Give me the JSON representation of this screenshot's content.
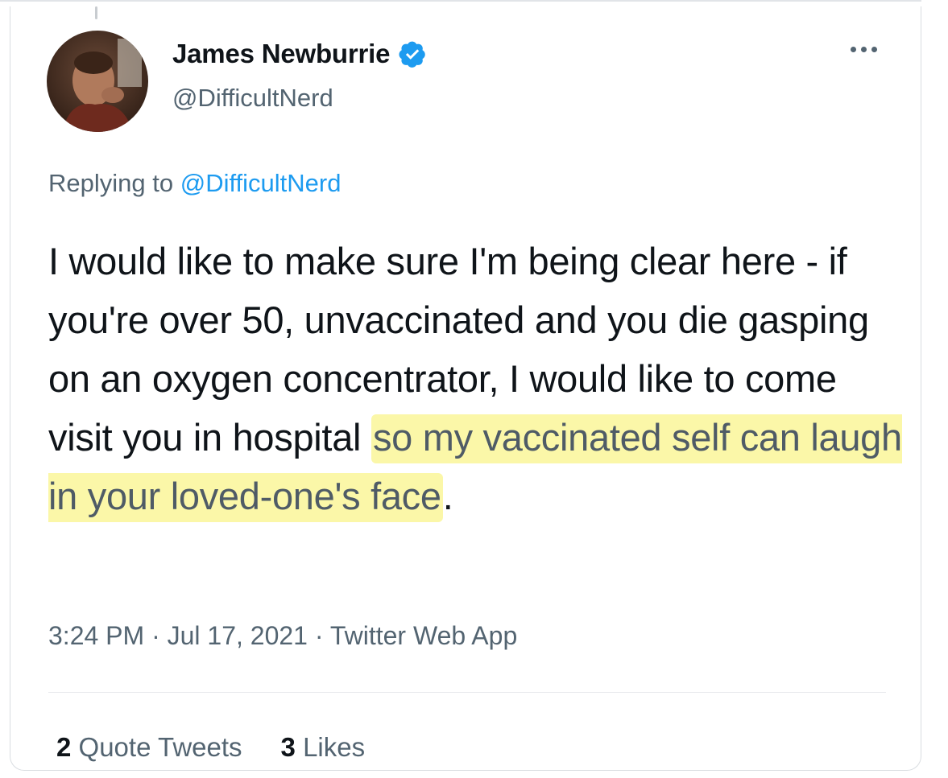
{
  "author": {
    "display_name": "James Newburrie",
    "handle": "@DifficultNerd",
    "verified_icon": "verified-badge-icon",
    "avatar_icon": "avatar-photo"
  },
  "reply": {
    "prefix": "Replying to ",
    "mention": "@DifficultNerd"
  },
  "tweet": {
    "text_plain": "I would like to make sure I'm being clear here - if you're over 50, unvaccinated and you die gasping on an oxygen concentrator, I would like to come visit you in hospital",
    "text_highlight": "so my vaccinated self can laugh in your loved-one's face",
    "text_end": ".",
    "highlight_color": "#fbf7a8"
  },
  "meta": {
    "time": "3:24 PM",
    "separator": " · ",
    "date": "Jul 17, 2021",
    "source": "Twitter Web App"
  },
  "stats": {
    "quote_count": "2",
    "quote_label": "Quote Tweets",
    "likes_count": "3",
    "likes_label": "Likes"
  },
  "colors": {
    "accent": "#1d9bf0",
    "text_primary": "#0f1419",
    "text_secondary": "#536471"
  }
}
